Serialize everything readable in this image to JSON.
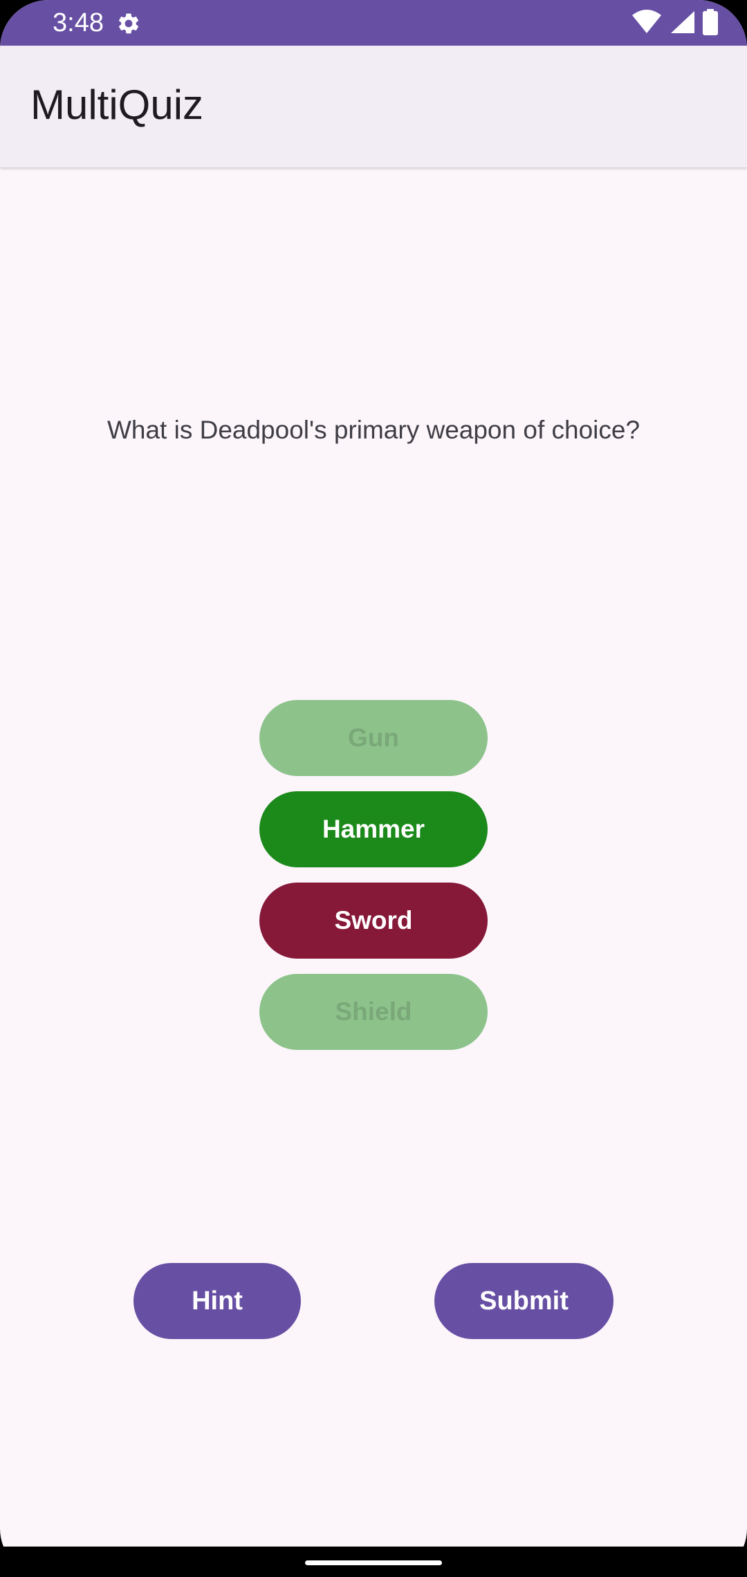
{
  "status_bar": {
    "time": "3:48",
    "icons": [
      "settings-gear-icon",
      "wifi-icon",
      "signal-icon",
      "battery-icon"
    ]
  },
  "app_bar": {
    "title": "MultiQuiz"
  },
  "quiz": {
    "question": "What is Deadpool's primary weapon of choice?",
    "answers": [
      {
        "label": "Gun",
        "state": "disabled"
      },
      {
        "label": "Hammer",
        "state": "correct"
      },
      {
        "label": "Sword",
        "state": "incorrect"
      },
      {
        "label": "Shield",
        "state": "disabled"
      }
    ]
  },
  "actions": {
    "hint_label": "Hint",
    "submit_label": "Submit"
  },
  "colors": {
    "primary": "#6750a4",
    "correct": "#1b8a1b",
    "incorrect": "#861838",
    "disabled": "#8dc38b",
    "background": "#fcf6fb",
    "app_bar": "#f2ecf5"
  }
}
